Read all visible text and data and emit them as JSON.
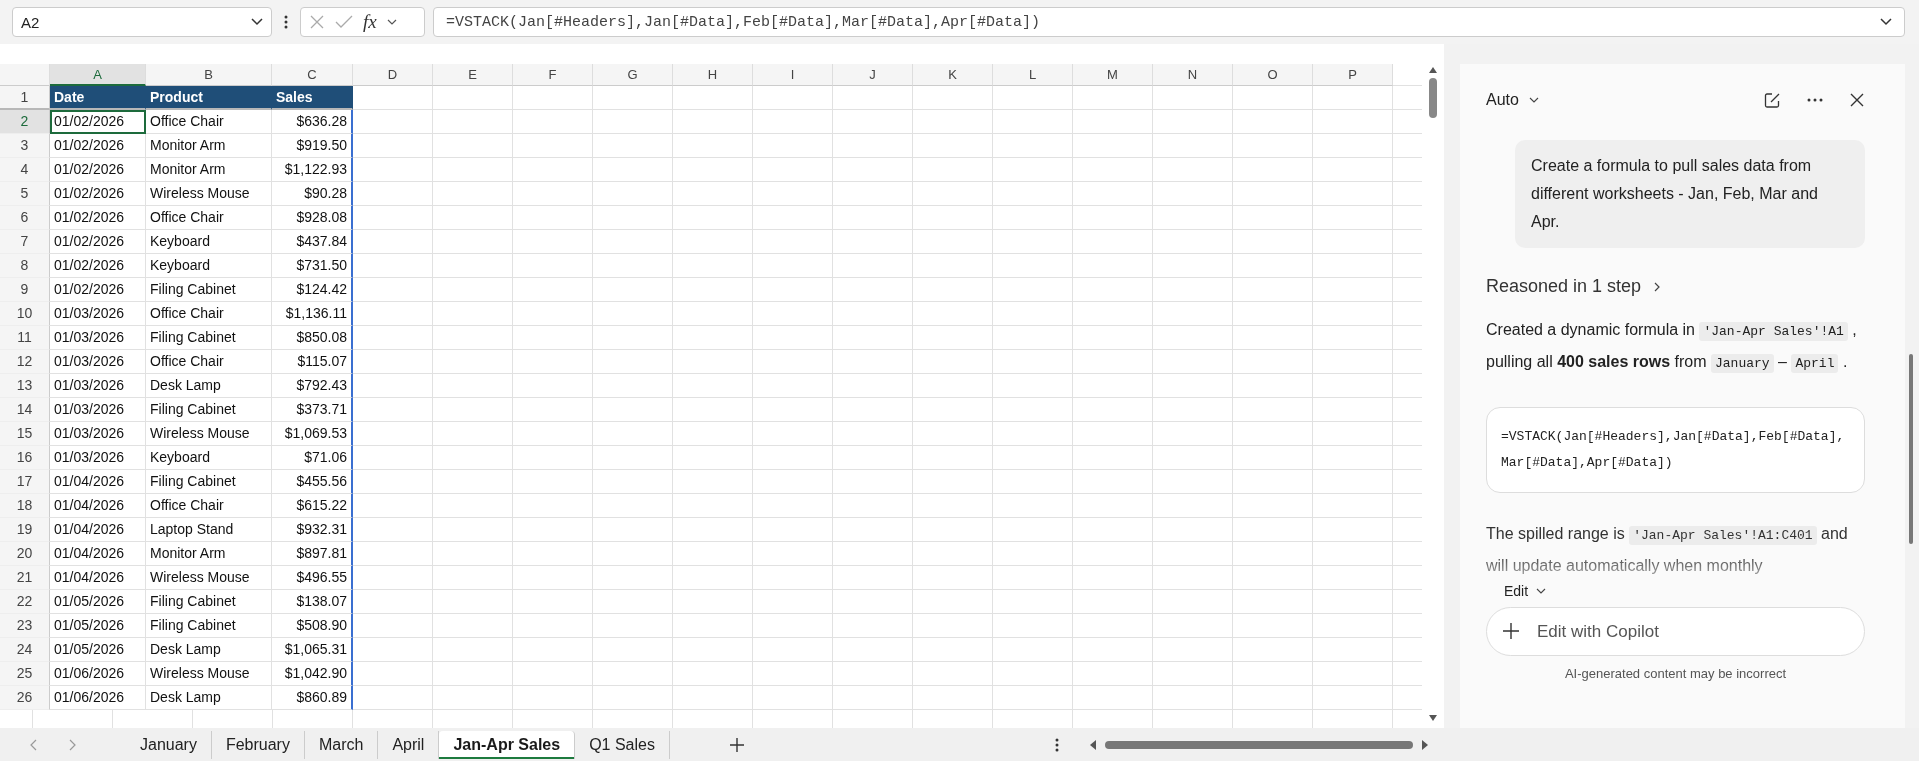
{
  "formula_bar": {
    "name_box": "A2",
    "function_label": "fx",
    "formula": "=VSTACK(Jan[#Headers],Jan[#Data],Feb[#Data],Mar[#Data],Apr[#Data])"
  },
  "columns": [
    {
      "label": "A",
      "selected": true
    },
    {
      "label": "B",
      "selected": false
    },
    {
      "label": "C",
      "selected": false
    },
    {
      "label": "D",
      "selected": false
    },
    {
      "label": "E",
      "selected": false
    },
    {
      "label": "F",
      "selected": false
    },
    {
      "label": "G",
      "selected": false
    },
    {
      "label": "H",
      "selected": false
    },
    {
      "label": "I",
      "selected": false
    },
    {
      "label": "J",
      "selected": false
    },
    {
      "label": "K",
      "selected": false
    },
    {
      "label": "L",
      "selected": false
    },
    {
      "label": "M",
      "selected": false
    },
    {
      "label": "N",
      "selected": false
    },
    {
      "label": "O",
      "selected": false
    },
    {
      "label": "P",
      "selected": false
    }
  ],
  "rows": [
    {
      "number": "1",
      "kind": "header",
      "selected": false,
      "cells": [
        "Date",
        "Product",
        "Sales"
      ]
    },
    {
      "number": "2",
      "kind": "data",
      "selected": true,
      "cells": [
        "01/02/2026",
        "Office Chair",
        "$636.28"
      ]
    },
    {
      "number": "3",
      "kind": "data",
      "selected": false,
      "cells": [
        "01/02/2026",
        "Monitor Arm",
        "$919.50"
      ]
    },
    {
      "number": "4",
      "kind": "data",
      "selected": false,
      "cells": [
        "01/02/2026",
        "Monitor Arm",
        "$1,122.93"
      ]
    },
    {
      "number": "5",
      "kind": "data",
      "selected": false,
      "cells": [
        "01/02/2026",
        "Wireless Mouse",
        "$90.28"
      ]
    },
    {
      "number": "6",
      "kind": "data",
      "selected": false,
      "cells": [
        "01/02/2026",
        "Office Chair",
        "$928.08"
      ]
    },
    {
      "number": "7",
      "kind": "data",
      "selected": false,
      "cells": [
        "01/02/2026",
        "Keyboard",
        "$437.84"
      ]
    },
    {
      "number": "8",
      "kind": "data",
      "selected": false,
      "cells": [
        "01/02/2026",
        "Keyboard",
        "$731.50"
      ]
    },
    {
      "number": "9",
      "kind": "data",
      "selected": false,
      "cells": [
        "01/02/2026",
        "Filing Cabinet",
        "$124.42"
      ]
    },
    {
      "number": "10",
      "kind": "data",
      "selected": false,
      "cells": [
        "01/03/2026",
        "Office Chair",
        "$1,136.11"
      ]
    },
    {
      "number": "11",
      "kind": "data",
      "selected": false,
      "cells": [
        "01/03/2026",
        "Filing Cabinet",
        "$850.08"
      ]
    },
    {
      "number": "12",
      "kind": "data",
      "selected": false,
      "cells": [
        "01/03/2026",
        "Office Chair",
        "$115.07"
      ]
    },
    {
      "number": "13",
      "kind": "data",
      "selected": false,
      "cells": [
        "01/03/2026",
        "Desk Lamp",
        "$792.43"
      ]
    },
    {
      "number": "14",
      "kind": "data",
      "selected": false,
      "cells": [
        "01/03/2026",
        "Filing Cabinet",
        "$373.71"
      ]
    },
    {
      "number": "15",
      "kind": "data",
      "selected": false,
      "cells": [
        "01/03/2026",
        "Wireless Mouse",
        "$1,069.53"
      ]
    },
    {
      "number": "16",
      "kind": "data",
      "selected": false,
      "cells": [
        "01/03/2026",
        "Keyboard",
        "$71.06"
      ]
    },
    {
      "number": "17",
      "kind": "data",
      "selected": false,
      "cells": [
        "01/04/2026",
        "Filing Cabinet",
        "$455.56"
      ]
    },
    {
      "number": "18",
      "kind": "data",
      "selected": false,
      "cells": [
        "01/04/2026",
        "Office Chair",
        "$615.22"
      ]
    },
    {
      "number": "19",
      "kind": "data",
      "selected": false,
      "cells": [
        "01/04/2026",
        "Laptop Stand",
        "$932.31"
      ]
    },
    {
      "number": "20",
      "kind": "data",
      "selected": false,
      "cells": [
        "01/04/2026",
        "Monitor Arm",
        "$897.81"
      ]
    },
    {
      "number": "21",
      "kind": "data",
      "selected": false,
      "cells": [
        "01/04/2026",
        "Wireless Mouse",
        "$496.55"
      ]
    },
    {
      "number": "22",
      "kind": "data",
      "selected": false,
      "cells": [
        "01/05/2026",
        "Filing Cabinet",
        "$138.07"
      ]
    },
    {
      "number": "23",
      "kind": "data",
      "selected": false,
      "cells": [
        "01/05/2026",
        "Filing Cabinet",
        "$508.90"
      ]
    },
    {
      "number": "24",
      "kind": "data",
      "selected": false,
      "cells": [
        "01/05/2026",
        "Desk Lamp",
        "$1,065.31"
      ]
    },
    {
      "number": "25",
      "kind": "data",
      "selected": false,
      "cells": [
        "01/06/2026",
        "Wireless Mouse",
        "$1,042.90"
      ]
    },
    {
      "number": "26",
      "kind": "data",
      "selected": false,
      "cells": [
        "01/06/2026",
        "Desk Lamp",
        "$860.89"
      ]
    }
  ],
  "sheet_tabs": [
    {
      "label": "January",
      "selected": false
    },
    {
      "label": "February",
      "selected": false
    },
    {
      "label": "March",
      "selected": false
    },
    {
      "label": "April",
      "selected": false
    },
    {
      "label": "Jan-Apr Sales",
      "selected": true
    },
    {
      "label": "Q1 Sales",
      "selected": false
    }
  ],
  "copilot": {
    "mode": "Auto",
    "user_message": "Create a formula to pull sales data from different worksheets - Jan, Feb, Mar and Apr.",
    "reasoning": "Reasoned in 1 step",
    "response": [
      {
        "kind": "text",
        "text": "Created a dynamic formula in "
      },
      {
        "kind": "code",
        "text": "'Jan-Apr Sales'!A1"
      },
      {
        "kind": "text",
        "text": " , pulling all **400 sales rows** from "
      },
      {
        "kind": "code",
        "text": "January"
      },
      {
        "kind": "text",
        "text": " – "
      },
      {
        "kind": "code",
        "text": "April"
      },
      {
        "kind": "text",
        "text": " ."
      }
    ],
    "code_block": "=VSTACK(Jan[#Headers],Jan[#Data],Feb[#Data],Mar[#Data],Apr[#Data])",
    "followup": [
      {
        "kind": "text",
        "text": "The spilled range is "
      },
      {
        "kind": "code",
        "text": "'Jan-Apr Sales'!A1:C401"
      },
      {
        "kind": "text",
        "text": " and will update automatically when monthly"
      }
    ],
    "edit_menu": "Edit",
    "input_placeholder": "Edit with Copilot",
    "disclaimer": "AI-generated content may be incorrect"
  }
}
